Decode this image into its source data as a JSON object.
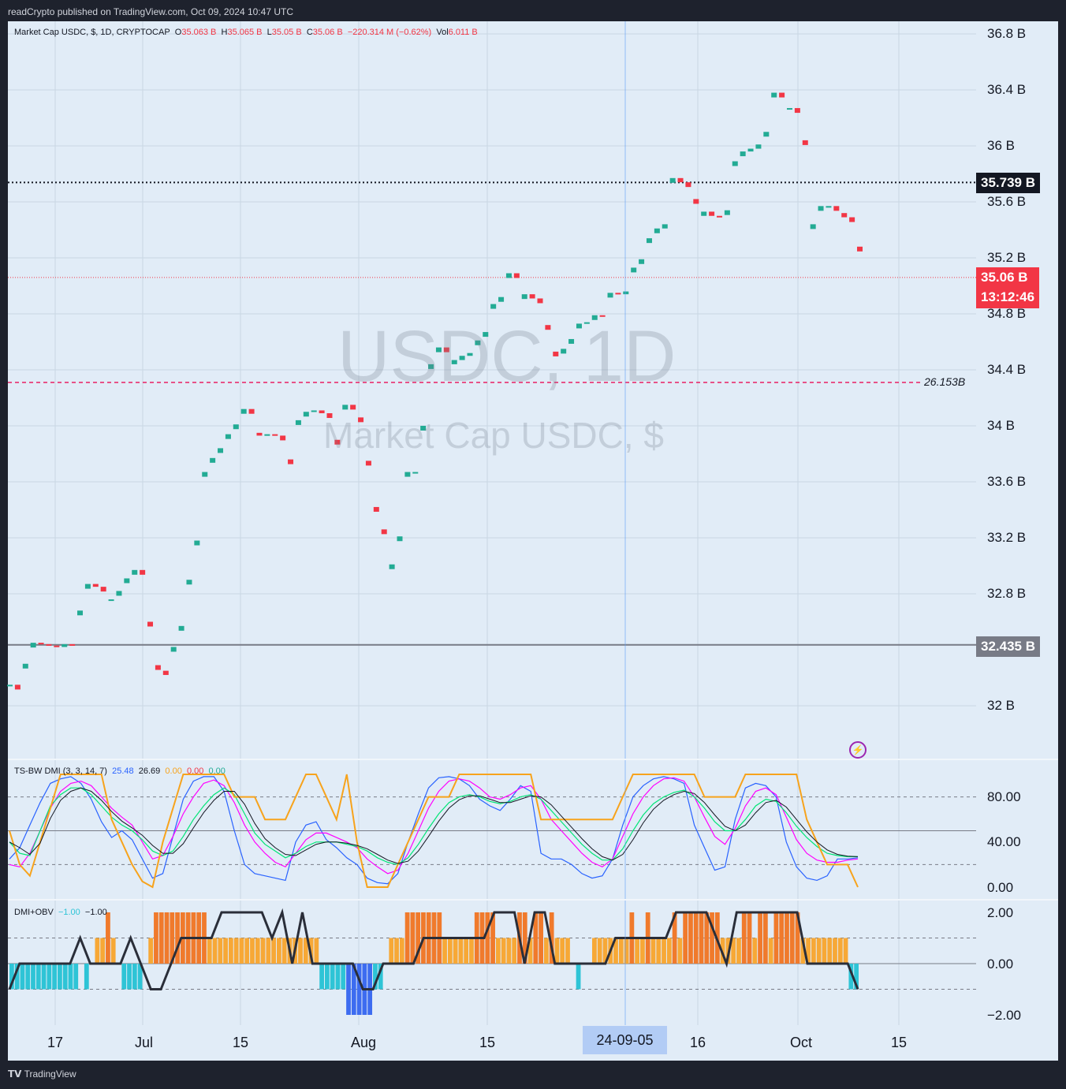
{
  "publisher_line": "readCrypto published on TradingView.com, Oct 09, 2024 10:47 UTC",
  "legend_main": {
    "symbol": "Market Cap USDC, $, 1D, CRYPTOCAP",
    "o_label": "O",
    "o_val": "35.063 B",
    "h_label": "H",
    "h_val": "35.065 B",
    "l_label": "L",
    "l_val": "35.05 B",
    "c_label": "C",
    "c_val": "35.06 B",
    "change": "−220.314 M (−0.62%)",
    "vol_label": "Vol",
    "vol_val": "6.011 B"
  },
  "watermark": {
    "line1": "USDC, 1D",
    "line2": "Market Cap USDC, $"
  },
  "price_axis": [
    "36.8 B",
    "36.4 B",
    "36 B",
    "35.6 B",
    "35.2 B",
    "34.8 B",
    "34.4 B",
    "34 B",
    "33.6 B",
    "33.2 B",
    "32.8 B",
    "32 B"
  ],
  "time_axis": [
    "17",
    "Jul",
    "15",
    "Aug",
    "15",
    "16",
    "Oct",
    "15"
  ],
  "crosshair_date": "24-09-05",
  "tags": {
    "high_line": "35.739 B",
    "current_price": "35.06 B",
    "countdown": "13:12:46",
    "low_line": "32.435 B",
    "pink_level": "26.153B"
  },
  "dmi_legend": {
    "name": "TS-BW DMI (3, 3, 14, 7)",
    "v1": "25.48",
    "v2": "26.69",
    "v3": "0.00",
    "v4": "0.00",
    "v5": "0.00",
    "axis": [
      "80.00",
      "40.00",
      "0.00"
    ]
  },
  "obv_legend": {
    "name": "DMI+OBV",
    "v1": "−1.00",
    "v2": "−1.00",
    "axis": [
      "2.00",
      "0.00",
      "−2.00"
    ]
  },
  "footer": "TradingView",
  "colors": {
    "up": "#22ab94",
    "down": "#f23645",
    "pink": "#e91e63",
    "blue": "#2962ff",
    "orange": "#f7a31c",
    "green": "#00e676",
    "magenta": "#ff00ff"
  },
  "chart_data": [
    {
      "type": "candlestick",
      "title": "Market Cap USDC, $, 1D, CRYPTOCAP",
      "unit": "B",
      "ylim": [
        31.9,
        36.85
      ],
      "x_ticks": [
        "17",
        "Jul",
        "15",
        "Aug",
        "15",
        "16",
        "Oct",
        "15"
      ],
      "closes": [
        32.15,
        32.08,
        32.3,
        32.45,
        32.44,
        32.43,
        32.42,
        32.44,
        32.43,
        32.68,
        32.87,
        32.85,
        32.75,
        32.76,
        32.82,
        32.91,
        32.97,
        32.6,
        32.29,
        32.25,
        32.22,
        32.42,
        32.57,
        32.9,
        33.18,
        33.67,
        33.77,
        33.84,
        33.94,
        34.01,
        34.12,
        33.95,
        33.93,
        33.94,
        33.93,
        33.76,
        33.62,
        34.04,
        34.1,
        34.11,
        34.09,
        33.9,
        33.8,
        34.15,
        34.06,
        33.75,
        33.42,
        33.26,
        32.95,
        33.01,
        33.21,
        33.67,
        33.67,
        34.0,
        34.44,
        34.56,
        34.44,
        34.47,
        34.5,
        34.52,
        34.61,
        34.67,
        34.87,
        34.92,
        35.09,
        34.87,
        34.94,
        34.91,
        34.72,
        34.53,
        34.48,
        34.55,
        34.62,
        34.73,
        34.74,
        34.79,
        34.78,
        34.95,
        34.94,
        34.96,
        35.13,
        35.19,
        35.34,
        35.41,
        35.44,
        35.77,
        35.74,
        35.62,
        35.5,
        35.53,
        35.5,
        35.49,
        35.54,
        35.89,
        35.96,
        35.98,
        36.01,
        36.1,
        36.38,
        36.27,
        36.27,
        36.04,
        35.35,
        35.44,
        35.57,
        35.57,
        35.52,
        35.49,
        35.28,
        35.06
      ],
      "levels": {
        "high_line": 35.739,
        "current": 35.06,
        "low_line": 32.435
      }
    },
    {
      "type": "line",
      "title": "TS-BW DMI (3, 3, 14, 7)",
      "ylim": [
        0,
        100
      ],
      "ref_lines": [
        80,
        50,
        20
      ],
      "series": [
        {
          "name": "",
          "values": [
            25,
            35,
            55,
            75,
            92,
            96,
            98,
            92,
            78,
            58,
            44,
            50,
            42,
            25,
            8,
            12,
            45,
            78,
            94,
            98,
            98,
            85,
            50,
            20,
            12,
            10,
            8,
            6,
            40,
            55,
            58,
            42,
            35,
            26,
            20,
            8,
            4,
            3,
            12,
            40,
            65,
            88,
            97,
            98,
            96,
            90,
            78,
            72,
            68,
            78,
            90,
            85,
            30,
            25,
            25,
            20,
            12,
            8,
            10,
            25,
            55,
            80,
            90,
            96,
            98,
            96,
            92,
            55,
            35,
            15,
            18,
            60,
            88,
            92,
            90,
            80,
            40,
            18,
            8,
            6,
            10,
            25,
            25,
            26
          ]
        },
        {
          "name": "",
          "values": [
            20,
            18,
            30,
            50,
            70,
            85,
            92,
            94,
            90,
            80,
            70,
            62,
            55,
            40,
            25,
            28,
            45,
            65,
            80,
            92,
            95,
            90,
            75,
            55,
            40,
            30,
            22,
            18,
            30,
            42,
            48,
            48,
            44,
            40,
            35,
            25,
            18,
            12,
            15,
            30,
            50,
            70,
            85,
            94,
            96,
            94,
            88,
            80,
            78,
            82,
            88,
            90,
            78,
            60,
            50,
            40,
            30,
            22,
            18,
            25,
            45,
            65,
            80,
            90,
            96,
            97,
            94,
            80,
            62,
            45,
            38,
            52,
            72,
            85,
            88,
            82,
            62,
            42,
            30,
            24,
            22,
            22,
            24,
            25
          ]
        },
        {
          "name": "",
          "values": [
            40,
            30,
            28,
            50,
            72,
            82,
            88,
            88,
            82,
            72,
            62,
            55,
            50,
            42,
            32,
            28,
            32,
            45,
            60,
            72,
            82,
            88,
            82,
            65,
            48,
            38,
            32,
            26,
            30,
            36,
            40,
            40,
            40,
            38,
            36,
            32,
            26,
            22,
            20,
            26,
            38,
            52,
            65,
            75,
            80,
            82,
            80,
            76,
            74,
            76,
            80,
            82,
            78,
            68,
            58,
            48,
            38,
            30,
            24,
            24,
            34,
            50,
            64,
            74,
            80,
            84,
            86,
            80,
            70,
            58,
            50,
            50,
            60,
            72,
            78,
            76,
            66,
            54,
            44,
            36,
            30,
            28,
            27,
            27
          ]
        },
        {
          "name": "",
          "values": [
            50,
            20,
            10,
            40,
            70,
            100,
            100,
            100,
            100,
            100,
            60,
            40,
            20,
            5,
            0,
            40,
            70,
            100,
            100,
            100,
            100,
            100,
            80,
            80,
            80,
            60,
            60,
            60,
            80,
            100,
            100,
            80,
            60,
            100,
            40,
            0,
            0,
            0,
            20,
            40,
            60,
            80,
            80,
            80,
            100,
            100,
            100,
            100,
            100,
            100,
            100,
            100,
            60,
            60,
            60,
            60,
            60,
            60,
            60,
            60,
            80,
            100,
            100,
            100,
            100,
            100,
            100,
            100,
            80,
            80,
            80,
            80,
            100,
            100,
            100,
            100,
            100,
            100,
            60,
            40,
            20,
            20,
            20,
            0
          ]
        }
      ]
    },
    {
      "type": "bar",
      "title": "DMI+OBV",
      "ylim": [
        -2,
        2
      ],
      "ref_lines": [
        1,
        0,
        -1
      ],
      "values": [
        -1,
        -1,
        -1,
        -1,
        -1,
        -1,
        -1,
        -1,
        -1,
        -1,
        -1,
        -1,
        -1,
        0,
        -1,
        0,
        1,
        1,
        2,
        1,
        0,
        -1,
        -1,
        -1,
        -1,
        0,
        1,
        2,
        2,
        2,
        2,
        2,
        2,
        2,
        2,
        2,
        2,
        1,
        1,
        1,
        1,
        1,
        1,
        1,
        1,
        1,
        1,
        1,
        1,
        1,
        1,
        1,
        1,
        1,
        1,
        1,
        1,
        1,
        -1,
        -1,
        -1,
        -1,
        -1,
        -2,
        -2,
        -2,
        -2,
        -2,
        -1,
        -1,
        0,
        1,
        1,
        1,
        2,
        2,
        2,
        2,
        2,
        2,
        2,
        1,
        1,
        1,
        1,
        1,
        1,
        2,
        2,
        2,
        2,
        1,
        1,
        1,
        1,
        2,
        2,
        1,
        2,
        2,
        1,
        2,
        1,
        1,
        1,
        0,
        -1,
        0,
        0,
        1,
        1,
        1,
        1,
        1,
        1,
        1,
        2,
        1,
        1,
        2,
        1,
        1,
        1,
        1,
        2,
        1,
        2,
        2,
        2,
        2,
        2,
        2,
        2,
        1,
        1,
        1,
        1,
        2,
        2,
        1,
        2,
        2,
        1,
        2,
        2,
        2,
        2,
        2,
        1,
        1,
        1,
        1,
        1,
        1,
        1,
        1,
        1,
        -1,
        -1
      ],
      "line_values": [
        -1,
        0,
        0,
        0,
        0,
        0,
        0,
        1,
        0,
        0,
        0,
        0,
        1,
        0,
        -1,
        -1,
        0,
        1,
        1,
        1,
        1,
        2,
        2,
        2,
        2,
        2,
        1,
        2,
        0,
        2,
        0,
        0,
        0,
        0,
        0,
        -1,
        -1,
        0,
        0,
        0,
        0,
        1,
        1,
        1,
        1,
        1,
        1,
        1,
        2,
        2,
        2,
        0,
        2,
        2,
        0,
        0,
        0,
        0,
        0,
        0,
        1,
        1,
        1,
        1,
        1,
        1,
        2,
        2,
        2,
        2,
        1,
        0,
        2,
        2,
        2,
        2,
        2,
        2,
        2,
        0,
        0,
        0,
        0,
        0,
        -1
      ]
    }
  ]
}
